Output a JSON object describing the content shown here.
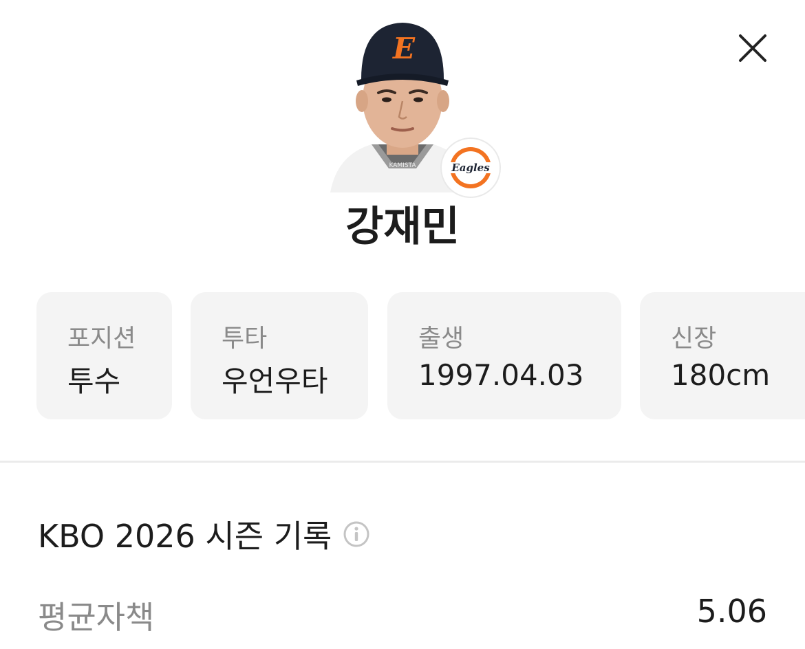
{
  "player": {
    "name": "강재민",
    "team_logo_text": "Eagles",
    "cap_letter": "E",
    "jersey_text": "KAMISTA"
  },
  "info_cards": [
    {
      "label": "포지션",
      "value": "투수"
    },
    {
      "label": "투타",
      "value": "우언우타"
    },
    {
      "label": "출생",
      "value": "1997.04.03"
    },
    {
      "label": "신장",
      "value": "180cm"
    }
  ],
  "season": {
    "title": "KBO 2026 시즌 기록",
    "stats": [
      {
        "label": "평균자책",
        "value": "5.06"
      }
    ]
  },
  "colors": {
    "accent_orange": "#f37321",
    "card_bg": "#f4f4f4",
    "cap_navy": "#1d2433"
  },
  "icons": {
    "close": "close-icon",
    "info": "info-icon",
    "team": "team-logo"
  }
}
